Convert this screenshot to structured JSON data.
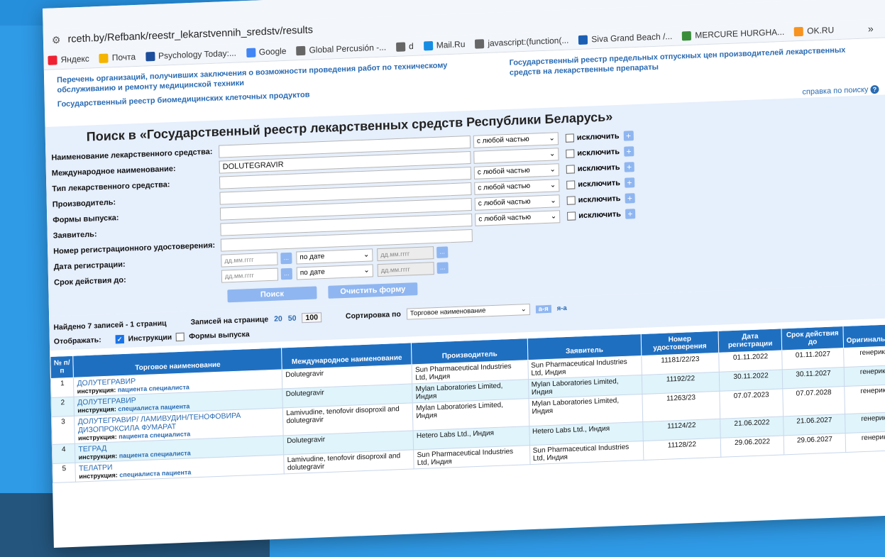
{
  "browser": {
    "url": "rceth.by/Refbank/reestr_lekarstvennih_sredstv/results",
    "bookmarks": [
      {
        "label": "Яндекс",
        "icon": "yandex-icon",
        "color": "#e23"
      },
      {
        "label": "Почта",
        "icon": "mail-icon",
        "color": "#f4b400"
      },
      {
        "label": "Psychology Today:...",
        "icon": "pt-icon",
        "color": "#1d4e9b"
      },
      {
        "label": "Google",
        "icon": "google-icon",
        "color": "#4285f4"
      },
      {
        "label": "Global Percusión -...",
        "icon": "globe-icon",
        "color": "#666"
      },
      {
        "label": "d",
        "icon": "globe-icon",
        "color": "#666"
      },
      {
        "label": "Mail.Ru",
        "icon": "mailru-icon",
        "color": "#168de2"
      },
      {
        "label": "javascript:(function(...",
        "icon": "globe-icon",
        "color": "#666"
      },
      {
        "label": "Siva Grand Beach /...",
        "icon": "siva-icon",
        "color": "#1a5fb4"
      },
      {
        "label": "MERCURE HURGHA...",
        "icon": "mercure-icon",
        "color": "#3a8e3a"
      },
      {
        "label": "OK.RU",
        "icon": "ok-icon",
        "color": "#f7931e"
      }
    ],
    "more_label": "»"
  },
  "top_links": {
    "link1": "Перечень организаций, получивших заключения о возможности проведения работ по техническому обслуживанию и ремонту медицинской техники",
    "link2": "Государственный реестр биомедицинских клеточных продуктов",
    "link3": "Государственный реестр предельных отпускных цен производителей лекарственных средств на лекарственные препараты",
    "help": "справка по поиску"
  },
  "search": {
    "title": "Поиск в «Государственный реестр лекарственных средств Республики Беларусь»",
    "fields": [
      {
        "label": "Наименование лекарственного средства:",
        "value": "",
        "mode": "с любой частью",
        "exclude": "исключить"
      },
      {
        "label": "Международное наименование:",
        "value": "DOLUTEGRAVIR",
        "mode": "",
        "exclude": "исключить"
      },
      {
        "label": "Тип лекарственного средства:",
        "value": "",
        "mode": "с любой частью",
        "exclude": "исключить"
      },
      {
        "label": "Производитель:",
        "value": "",
        "mode": "с любой частью",
        "exclude": "исключить"
      },
      {
        "label": "Формы выпуска:",
        "value": "",
        "mode": "с любой частью",
        "exclude": "исключить"
      },
      {
        "label": "Заявитель:",
        "value": "",
        "mode": "с любой частью",
        "exclude": "исключить"
      }
    ],
    "first_row_mode": "с любой частью",
    "reg_cert_label": "Номер регистрационного удостоверения:",
    "reg_date_label": "Дата регистрации:",
    "valid_until_label": "Срок действия до:",
    "date_placeholder": "дд.мм.гггг",
    "date_mode": "по дате",
    "dots": "...",
    "search_button": "Поиск",
    "clear_button": "Очистить форму"
  },
  "results": {
    "found": "Найдено  7 записей - 1 страниц",
    "per_page_label": "Записей на странице",
    "per_page": [
      "20",
      "50",
      "100"
    ],
    "sort_label": "Сортировка по",
    "sort_value": "Торговое наименование",
    "az": "а-я",
    "za": "я-а",
    "show_label": "Отображать:",
    "show_instr": "Инструкции",
    "show_forms": "Формы выпуска"
  },
  "table": {
    "headers": [
      "№ п/п",
      "Торговое наименование",
      "Международное наименование",
      "Производитель",
      "Заявитель",
      "Номер удостоверения",
      "Дата регистрации",
      "Срок действия до",
      "Оригинальное"
    ],
    "instr_label": "инструкция:",
    "rows": [
      {
        "n": "1",
        "trade": "ДОЛУТЕГРАВИР",
        "instr": "пациента специалиста",
        "inn": "Dolutegravir",
        "maker": "Sun Pharmaceutical Industries Ltd, Индия",
        "applicant": "Sun Pharmaceutical Industries Ltd, Индия",
        "cert": "11181/22/23",
        "reg": "01.11.2022",
        "until": "01.11.2027",
        "orig": "генерик"
      },
      {
        "n": "2",
        "trade": "ДОЛУТЕГРАВИР",
        "instr": "специалиста пациента",
        "inn": "Dolutegravir",
        "maker": "Mylan Laboratories Limited, Индия",
        "applicant": "Mylan Laboratories Limited, Индия",
        "cert": "11192/22",
        "reg": "30.11.2022",
        "until": "30.11.2027",
        "orig": "генерик"
      },
      {
        "n": "3",
        "trade": "ДОЛУТЕГРАВИР/ ЛАМИВУДИН/ТЕНОФОВИРА ДИЗОПРОКСИЛА ФУМАРАТ",
        "instr": "пациента специалиста",
        "inn": "Lamivudine, tenofovir disoproxil and dolutegravir",
        "maker": "Mylan Laboratories Limited, Индия",
        "applicant": "Mylan Laboratories Limited, Индия",
        "cert": "11263/23",
        "reg": "07.07.2023",
        "until": "07.07.2028",
        "orig": "генерик"
      },
      {
        "n": "4",
        "trade": "ТЕГРАД",
        "instr": "пациента специалиста",
        "inn": "Dolutegravir",
        "maker": "Hetero Labs Ltd., Индия",
        "applicant": "Hetero Labs Ltd., Индия",
        "cert": "11124/22",
        "reg": "21.06.2022",
        "until": "21.06.2027",
        "orig": "генерик"
      },
      {
        "n": "5",
        "trade": "ТЕЛАТРИ",
        "instr": "специалиста пациента",
        "inn": "Lamivudine, tenofovir disoproxil and dolutegravir",
        "maker": "Sun Pharmaceutical Industries Ltd, Индия",
        "applicant": "Sun Pharmaceutical Industries Ltd, Индия",
        "cert": "11128/22",
        "reg": "29.06.2022",
        "until": "29.06.2027",
        "orig": "генерик"
      }
    ]
  }
}
